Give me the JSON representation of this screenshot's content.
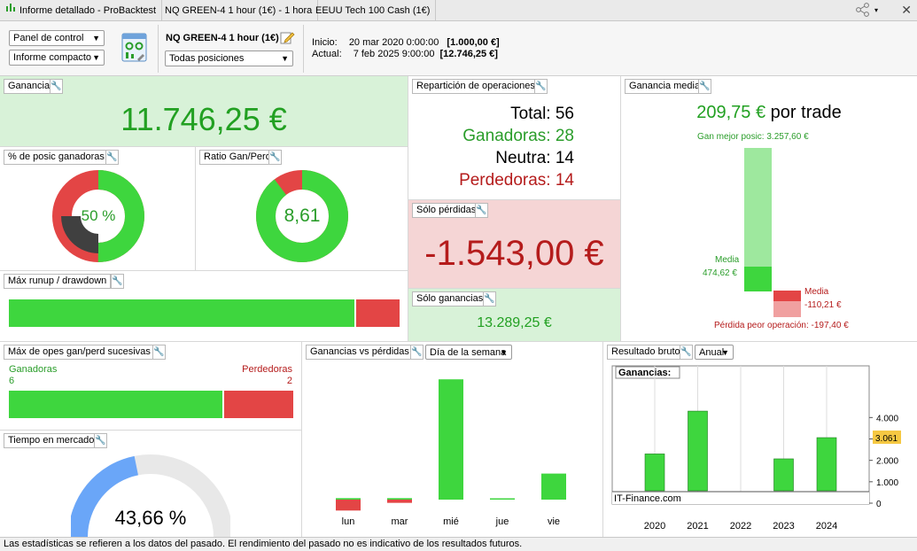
{
  "tabs": [
    {
      "label": "Informe detallado - ProBacktest"
    },
    {
      "label": "NQ GREEN-4 1 hour (1€) - 1 hora"
    },
    {
      "label": "EEUU Tech 100 Cash (1€)"
    }
  ],
  "toolbar": {
    "panel_select": "Panel de control",
    "report_select": "Informe compacto",
    "system_name": "NQ GREEN-4 1 hour (1€)",
    "positions_select": "Todas posiciones",
    "start_label": "Inicio:",
    "start_date": "20 mar 2020 0:00:00",
    "start_value": "[1.000,00 €]",
    "end_label": "Actual:",
    "end_date": "7 feb 2025 9:00:00",
    "end_value": "[12.746,25 €]"
  },
  "ganancia": {
    "title": "Ganancia",
    "value": "11.746,25 €"
  },
  "pct_winning": {
    "title": "% de posic ganadoras",
    "value": "50 %",
    "fraction": 0.5
  },
  "ratio": {
    "title": "Ratio Gan/Perd",
    "value": "8,61",
    "fraction": 0.896
  },
  "runup": {
    "title": "Máx runup / drawdown",
    "green_fraction": 0.884
  },
  "reparticion": {
    "title": "Repartición de operaciones",
    "total_label": "Total:",
    "total": "56",
    "win_label": "Ganadoras:",
    "win": "28",
    "neutral_label": "Neutra:",
    "neutral": "14",
    "lose_label": "Perdedoras:",
    "lose": "14"
  },
  "solo_perdidas": {
    "title": "Sólo pérdidas",
    "value": "-1.543,00 €"
  },
  "solo_ganancias": {
    "title": "Sólo ganancias",
    "value": "13.289,25 €"
  },
  "ganancia_media": {
    "title": "Ganancia media",
    "value": "209,75 €",
    "suffix": "por trade",
    "best_label": "Gan mejor posic: 3.257,60 €",
    "media_win_label": "Media",
    "media_win_value": "474,62 €",
    "media_lose_label": "Media",
    "media_lose_value": "-110,21 €",
    "worst_label": "Pérdida peor operación: -197,40 €"
  },
  "consecutive": {
    "title": "Máx de opes gan/perd sucesivas",
    "win_label": "Ganadoras",
    "win_value": "6",
    "lose_label": "Perdedoras",
    "lose_value": "2",
    "green_fraction": 0.75
  },
  "market_time": {
    "title": "Tiempo en mercado",
    "value": "43,66 %",
    "fraction": 0.4366
  },
  "gvp": {
    "title": "Ganancias vs pérdidas",
    "select": "Día de la semana",
    "chart_data": {
      "type": "bar",
      "categories": [
        "lun",
        "mar",
        "mié",
        "jue",
        "vie"
      ],
      "series": [
        {
          "values": [
            60,
            60,
            4850,
            40,
            1050
          ]
        },
        {
          "values": [
            -440,
            -130,
            0,
            0,
            0
          ]
        }
      ]
    }
  },
  "resultado": {
    "title": "Resultado bruto",
    "select": "Anual",
    "legend": "Ganancias:",
    "watermark": "IT-Finance.com",
    "current_value": "3.061",
    "chart_data": {
      "type": "bar",
      "categories": [
        "2020",
        "2021",
        "2022",
        "2023",
        "2024"
      ],
      "values": [
        2300,
        4300,
        20,
        2070,
        3061
      ],
      "yticks": [
        "4.000",
        "3.000",
        "2.000",
        "1.000",
        "0"
      ],
      "ylim": [
        0,
        4800
      ],
      "current": 3061
    }
  },
  "status": "Las estadísticas se refieren a los datos del pasado. El rendimiento del pasado no es indicativo de los resultados futuros.",
  "colors": {
    "green": "#3ed63e",
    "red": "#e34545",
    "gray": "#404040",
    "blue": "#6aa6f8"
  }
}
